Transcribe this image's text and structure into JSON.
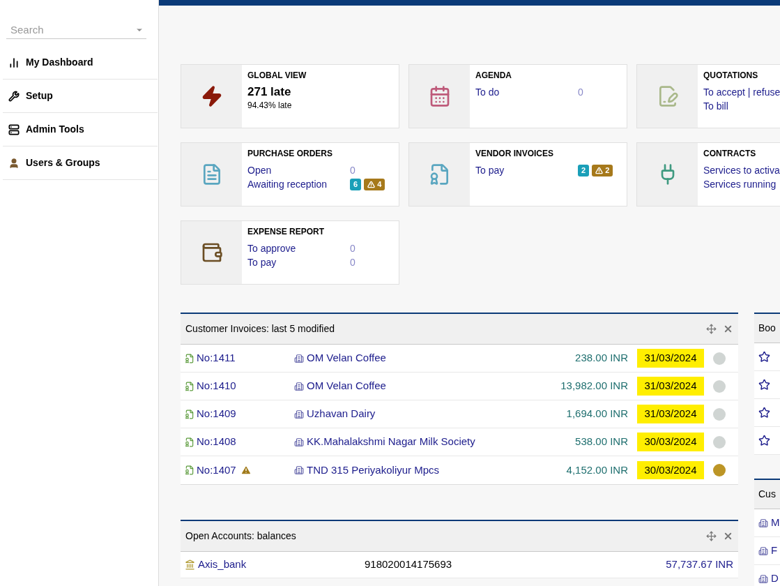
{
  "sidebar": {
    "search": {
      "placeholder": "Search"
    },
    "items": [
      {
        "label": "My Dashboard"
      },
      {
        "label": "Setup"
      },
      {
        "label": "Admin Tools"
      },
      {
        "label": "Users & Groups"
      }
    ]
  },
  "boxes": [
    {
      "title": "GLOBAL VIEW",
      "kind": "stat",
      "value": "271 late",
      "sub": "94.43% late"
    },
    {
      "title": "AGENDA",
      "kind": "list",
      "lines": [
        {
          "label": "To do",
          "count": "0"
        }
      ]
    },
    {
      "title": "QUOTATIONS",
      "kind": "list",
      "lines": [
        {
          "label": "To accept | refuse"
        },
        {
          "label": "To bill"
        }
      ]
    },
    {
      "title": "PURCHASE ORDERS",
      "kind": "list",
      "lines": [
        {
          "label": "Open",
          "count": "0"
        },
        {
          "label": "Awaiting reception",
          "badges": [
            {
              "kind": "count",
              "text": "6"
            },
            {
              "kind": "warning",
              "text": "4"
            }
          ]
        }
      ]
    },
    {
      "title": "VENDOR INVOICES",
      "kind": "list",
      "lines": [
        {
          "label": "To pay",
          "badges": [
            {
              "kind": "count",
              "text": "2"
            },
            {
              "kind": "warning",
              "text": "2"
            }
          ]
        }
      ]
    },
    {
      "title": "CONTRACTS",
      "kind": "list",
      "lines": [
        {
          "label": "Services to activa"
        },
        {
          "label": "Services running"
        }
      ]
    },
    {
      "title": "EXPENSE REPORT",
      "kind": "list",
      "lines": [
        {
          "label": "To approve",
          "count": "0"
        },
        {
          "label": "To pay",
          "count": "0"
        }
      ]
    }
  ],
  "invoices": {
    "title": "Customer Invoices: last 5 modified",
    "rows": [
      {
        "ref": "No:1411",
        "warning": false,
        "company": "OM Velan Coffee",
        "amount": "238.00 INR",
        "date": "31/03/2024",
        "color": "#d0d5d3"
      },
      {
        "ref": "No:1410",
        "warning": false,
        "company": "OM Velan Coffee",
        "amount": "13,982.00 INR",
        "date": "31/03/2024",
        "color": "#d0d5d3"
      },
      {
        "ref": "No:1409",
        "warning": false,
        "company": "Uzhavan Dairy",
        "amount": "1,694.00 INR",
        "date": "31/03/2024",
        "color": "#d0d5d3"
      },
      {
        "ref": "No:1408",
        "warning": false,
        "company": "KK.Mahalakshmi Nagar Milk Society",
        "amount": "538.00 INR",
        "date": "30/03/2024",
        "color": "#d0d5d3"
      },
      {
        "ref": "No:1407",
        "warning": true,
        "company": "TND 315 Periyakoliyur Mpcs",
        "amount": "4,152.00 INR",
        "date": "30/03/2024",
        "color": "#bc9526"
      }
    ]
  },
  "accounts": {
    "title": "Open Accounts: balances",
    "rows": [
      {
        "name": "Axis_bank",
        "number": "918020014175693",
        "balance": "57,737.67 INR"
      }
    ]
  },
  "side_panels": [
    {
      "title": "Boo",
      "kind": "stars",
      "rows": [
        {},
        {},
        {},
        {}
      ]
    },
    {
      "title": "Cus",
      "kind": "companies",
      "rows": [
        {
          "label": "M"
        },
        {
          "label": "F"
        },
        {
          "label": "D"
        }
      ]
    }
  ]
}
